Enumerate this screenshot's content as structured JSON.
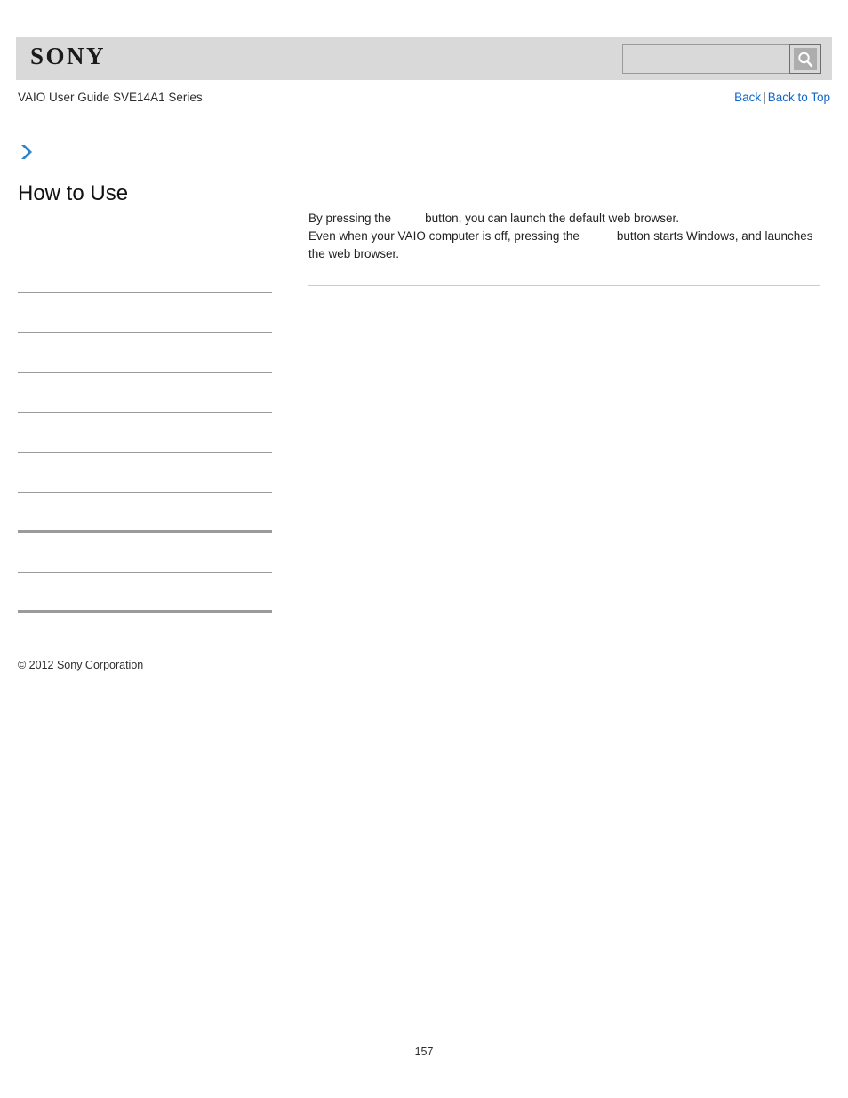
{
  "header": {
    "logo_text": "SONY",
    "search": {
      "value": "",
      "placeholder": "",
      "icon": "search-icon",
      "button_label": ""
    }
  },
  "subheader": {
    "guide_title": "VAIO User Guide SVE14A1 Series",
    "nav": {
      "back_label": "Back",
      "separator": "|",
      "back_to_top_label": "Back to Top"
    }
  },
  "sidebar": {
    "marker_icon": "chevron-right-icon",
    "heading": "How to Use",
    "items": [
      {
        "label": "",
        "divider": "thin"
      },
      {
        "label": "",
        "divider": "thin"
      },
      {
        "label": "",
        "divider": "thin"
      },
      {
        "label": "",
        "divider": "thin"
      },
      {
        "label": "",
        "divider": "thin"
      },
      {
        "label": "",
        "divider": "thin"
      },
      {
        "label": "",
        "divider": "thin"
      },
      {
        "label": "",
        "divider": "thick"
      },
      {
        "label": "",
        "divider": "thin"
      },
      {
        "label": "",
        "divider": "thick"
      }
    ]
  },
  "content": {
    "paragraph_1_part_1": "By pressing the",
    "paragraph_1_part_2": "button, you can launch the default web browser.",
    "paragraph_2_part_1": "Even when your VAIO computer is off, pressing the",
    "paragraph_2_part_2": "button starts Windows, and launches the web browser."
  },
  "footer": {
    "copyright": "© 2012 Sony Corporation",
    "page_number": "157"
  },
  "colors": {
    "header_bg": "#d9d9d9",
    "link": "#1166cc",
    "chevron": "#2e86c8",
    "divider": "#9b9b9b",
    "content_divider": "#cccccc"
  }
}
